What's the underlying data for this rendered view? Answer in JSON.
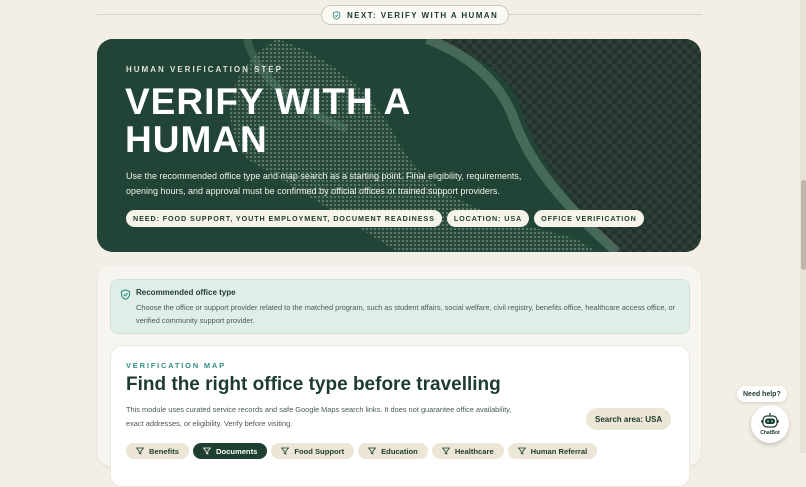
{
  "next_step": {
    "label": "NEXT: VERIFY WITH A HUMAN"
  },
  "hero": {
    "kicker": "HUMAN VERIFICATION STEP",
    "title": "VERIFY WITH A HUMAN",
    "description": "Use the recommended office type and map search as a starting point. Final eligibility, requirements, opening hours, and approval must be confirmed by official offices or trained support providers.",
    "tags": [
      "NEED: FOOD SUPPORT, YOUTH EMPLOYMENT, DOCUMENT READINESS",
      "LOCATION: USA",
      "OFFICE VERIFICATION"
    ]
  },
  "recommendation": {
    "title": "Recommended office type",
    "body": "Choose the office or support provider related to the matched program, such as student affairs, social welfare, civil registry, benefits office, healthcare access office, or verified community support provider."
  },
  "map": {
    "kicker": "VERIFICATION MAP",
    "title": "Find the right office type before travelling",
    "description": "This module uses curated service records and safe Google Maps search links. It does not guarantee office availability, exact addresses, or eligibility. Verify before visiting.",
    "search_area": "Search area: USA",
    "filters": [
      {
        "label": "Benefits",
        "active": false
      },
      {
        "label": "Documents",
        "active": true
      },
      {
        "label": "Food Support",
        "active": false
      },
      {
        "label": "Education",
        "active": false
      },
      {
        "label": "Healthcare",
        "active": false
      },
      {
        "label": "Human Referral",
        "active": false
      }
    ]
  },
  "help": {
    "bubble": "Need help?",
    "chatbot_label": "ChatBot"
  },
  "colors": {
    "brand_dark": "#1f3f31",
    "accent_teal": "#2f8f84",
    "background": "#f4efe6"
  },
  "icons": {
    "next": "shield-check-icon",
    "recommend": "shield-check-icon",
    "filter": "filter-funnel-icon",
    "chatbot": "robot-icon"
  }
}
